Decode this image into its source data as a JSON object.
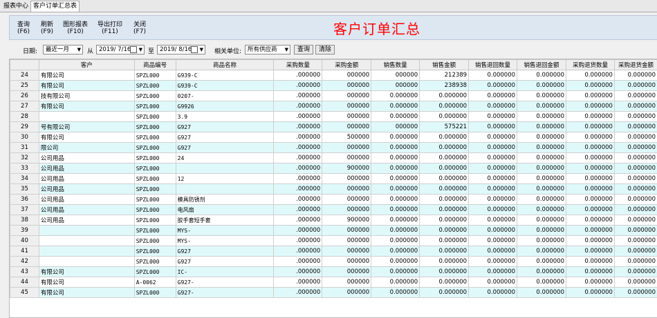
{
  "tabs": [
    "报表中心",
    "客户订单汇总表"
  ],
  "toolbar": [
    {
      "label": "查询",
      "key": "(F6)"
    },
    {
      "label": "刷新",
      "key": "(F9)"
    },
    {
      "label": "图形报表",
      "key": "(F10)"
    },
    {
      "label": "导出打印",
      "key": "(F11)"
    },
    {
      "label": "关闭",
      "key": "(F7)"
    }
  ],
  "title": "客户订单汇总",
  "filter": {
    "date_label": "日期:",
    "period": "最近一月",
    "from_label": "从",
    "from_date": "2019/ 7/16",
    "to_label": "至",
    "to_date": "2019/ 8/16",
    "unit_label": "相关单位:",
    "unit": "所有供应商",
    "query_btn": "查询",
    "clear_btn": "清除"
  },
  "columns": [
    "客户",
    "商品编号",
    "商品名称",
    "采购数量",
    "采购金额",
    "销售数量",
    "销售金额",
    "销售退回数量",
    "销售退回金额",
    "采购退货数量",
    "采购退货金额"
  ],
  "rows": [
    {
      "idx": "24",
      "cust": "有限公司",
      "code": "SPZL000",
      "name": "G939-C",
      "qty": ".000000",
      "amt": "000000",
      "sq": "000000",
      "sa": "212389",
      "rq": "0.000000",
      "ra": "0.000000",
      "pq": "0.000000",
      "pa": "0.000000"
    },
    {
      "idx": "25",
      "cust": "有限公司",
      "code": "SPZL000",
      "name": "G939-C",
      "qty": ".000000",
      "amt": "000000",
      "sq": "000000",
      "sa": "238938",
      "rq": "0.000000",
      "ra": "0.000000",
      "pq": "0.000000",
      "pa": "0.000000"
    },
    {
      "idx": "26",
      "cust": "技有限公司",
      "code": "SPZL000",
      "name": "0207-",
      "qty": ".000000",
      "amt": "000000",
      "sq": "0.000000",
      "sa": "0.000000",
      "rq": "0.000000",
      "ra": "0.000000",
      "pq": "0.000000",
      "pa": "0.000000"
    },
    {
      "idx": "27",
      "cust": "有限公司",
      "code": "SPZL000",
      "name": "G9926",
      "qty": ".000000",
      "amt": "000000",
      "sq": "0.000000",
      "sa": "0.000000",
      "rq": "0.000000",
      "ra": "0.000000",
      "pq": "0.000000",
      "pa": "0.000000"
    },
    {
      "idx": "28",
      "cust": "",
      "code": "SPZL000",
      "name": "3.9",
      "qty": ".000000",
      "amt": "000000",
      "sq": "0.000000",
      "sa": "0.000000",
      "rq": "0.000000",
      "ra": "0.000000",
      "pq": "0.000000",
      "pa": "0.000000"
    },
    {
      "idx": "29",
      "cust": "号有限公司",
      "code": "SPZL000",
      "name": "G927",
      "qty": ".000000",
      "amt": "000000",
      "sq": "000000",
      "sa": "575221",
      "rq": "0.000000",
      "ra": "0.000000",
      "pq": "0.000000",
      "pa": "0.000000"
    },
    {
      "idx": "30",
      "cust": "有限公司",
      "code": "SPZL000",
      "name": "G927",
      "qty": ".000000",
      "amt": "500000",
      "sq": "0.000000",
      "sa": "0.000000",
      "rq": "0.000000",
      "ra": "0.000000",
      "pq": "0.000000",
      "pa": "0.000000"
    },
    {
      "idx": "31",
      "cust": "限公司",
      "code": "SPZL000",
      "name": "G927",
      "qty": ".000000",
      "amt": "000000",
      "sq": "0.000000",
      "sa": "0.000000",
      "rq": "0.000000",
      "ra": "0.000000",
      "pq": "0.000000",
      "pa": "0.000000"
    },
    {
      "idx": "32",
      "cust": "公司用品",
      "code": "SPZL000",
      "name": "24",
      "qty": ".000000",
      "amt": "000000",
      "sq": "0.000000",
      "sa": "0.000000",
      "rq": "0.000000",
      "ra": "0.000000",
      "pq": "0.000000",
      "pa": "0.000000"
    },
    {
      "idx": "33",
      "cust": "公司用品",
      "code": "SPZL000",
      "name": "",
      "qty": ".000000",
      "amt": "900000",
      "sq": "0.000000",
      "sa": "0.000000",
      "rq": "0.000000",
      "ra": "0.000000",
      "pq": "0.000000",
      "pa": "0.000000"
    },
    {
      "idx": "34",
      "cust": "公司用品",
      "code": "SPZL000",
      "name": "12",
      "qty": ".000000",
      "amt": "000000",
      "sq": "0.000000",
      "sa": "0.000000",
      "rq": "0.000000",
      "ra": "0.000000",
      "pq": "0.000000",
      "pa": "0.000000"
    },
    {
      "idx": "35",
      "cust": "公司用品",
      "code": "SPZL000",
      "name": "",
      "qty": ".000000",
      "amt": "000000",
      "sq": "0.000000",
      "sa": "0.000000",
      "rq": "0.000000",
      "ra": "0.000000",
      "pq": "0.000000",
      "pa": "0.000000"
    },
    {
      "idx": "36",
      "cust": "公司用品",
      "code": "SPZL000",
      "name": "模具防锈剂",
      "qty": ".000000",
      "amt": "000000",
      "sq": "0.000000",
      "sa": "0.000000",
      "rq": "0.000000",
      "ra": "0.000000",
      "pq": "0.000000",
      "pa": "0.000000"
    },
    {
      "idx": "37",
      "cust": "公司用品",
      "code": "SPZL000",
      "name": "电风扇",
      "qty": ".000000",
      "amt": "000000",
      "sq": "0.000000",
      "sa": "0.000000",
      "rq": "0.000000",
      "ra": "0.000000",
      "pq": "0.000000",
      "pa": "0.000000"
    },
    {
      "idx": "38",
      "cust": "公司用品",
      "code": "SPZL000",
      "name": "胶手套短手套",
      "qty": ".000000",
      "amt": "900000",
      "sq": "0.000000",
      "sa": "0.000000",
      "rq": "0.000000",
      "ra": "0.000000",
      "pq": "0.000000",
      "pa": "0.000000"
    },
    {
      "idx": "39",
      "cust": "",
      "code": "SPZL000",
      "name": "MYS-",
      "qty": ".000000",
      "amt": "000000",
      "sq": "0.000000",
      "sa": "0.000000",
      "rq": "0.000000",
      "ra": "0.000000",
      "pq": "0.000000",
      "pa": "0.000000"
    },
    {
      "idx": "40",
      "cust": "",
      "code": "SPZL000",
      "name": "MYS-",
      "qty": ".000000",
      "amt": "000000",
      "sq": "0.000000",
      "sa": "0.000000",
      "rq": "0.000000",
      "ra": "0.000000",
      "pq": "0.000000",
      "pa": "0.000000"
    },
    {
      "idx": "41",
      "cust": "",
      "code": "SPZL000",
      "name": "G927",
      "qty": ".000000",
      "amt": "000000",
      "sq": "0.000000",
      "sa": "0.000000",
      "rq": "0.000000",
      "ra": "0.000000",
      "pq": "0.000000",
      "pa": "0.000000"
    },
    {
      "idx": "42",
      "cust": "",
      "code": "SPZL000",
      "name": "G927",
      "qty": ".000000",
      "amt": "000000",
      "sq": "0.000000",
      "sa": "0.000000",
      "rq": "0.000000",
      "ra": "0.000000",
      "pq": "0.000000",
      "pa": "0.000000"
    },
    {
      "idx": "43",
      "cust": "有限公司",
      "code": "SPZL000",
      "name": "IC-",
      "qty": ".000000",
      "amt": "000000",
      "sq": "0.000000",
      "sa": "0.000000",
      "rq": "0.000000",
      "ra": "0.000000",
      "pq": "0.000000",
      "pa": "0.000000"
    },
    {
      "idx": "44",
      "cust": "有限公司",
      "code": "A-0062",
      "name": "G927-",
      "qty": ".000000",
      "amt": "000000",
      "sq": "0.000000",
      "sa": "0.000000",
      "rq": "0.000000",
      "ra": "0.000000",
      "pq": "0.000000",
      "pa": "0.000000"
    },
    {
      "idx": "45",
      "cust": "有限公司",
      "code": "SPZL000",
      "name": "G927-",
      "qty": ".000000",
      "amt": "000000",
      "sq": "0.000000",
      "sa": "0.000000",
      "rq": "0.000000",
      "ra": "0.000000",
      "pq": "0.000000",
      "pa": "0.000000"
    }
  ]
}
